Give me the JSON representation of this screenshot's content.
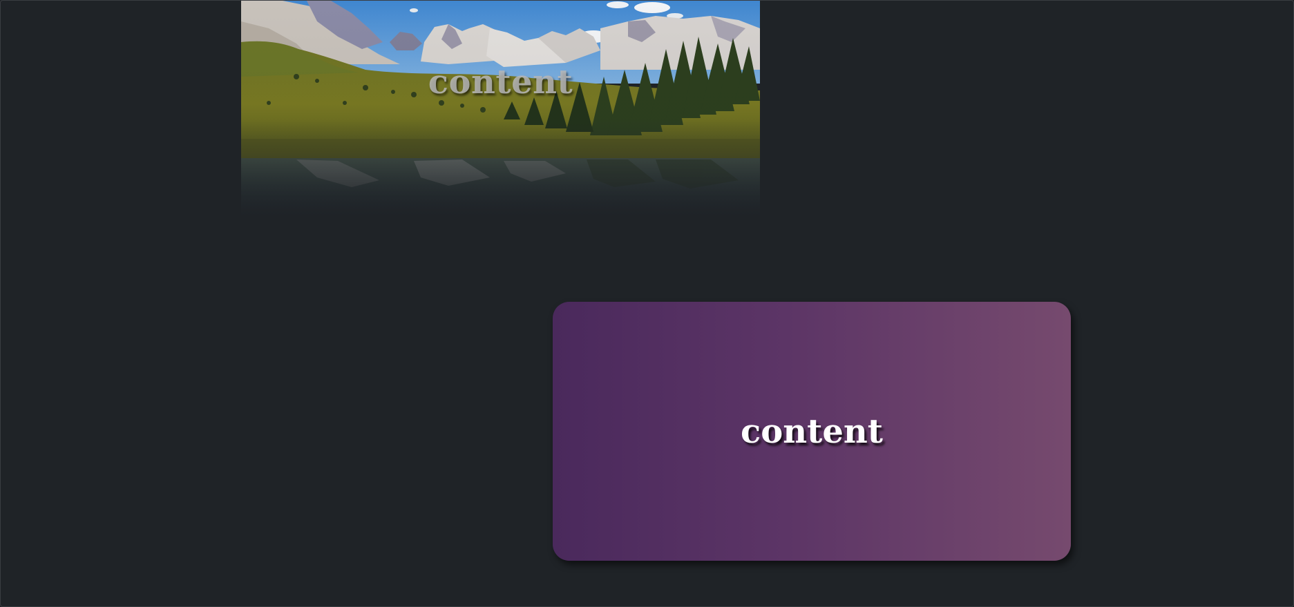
{
  "landscape_card": {
    "text": "content"
  },
  "gradient_card": {
    "text": "content"
  },
  "colors": {
    "page_background": "#1f2327",
    "gradient_start": "#4a295c",
    "gradient_end": "#764a6e"
  }
}
